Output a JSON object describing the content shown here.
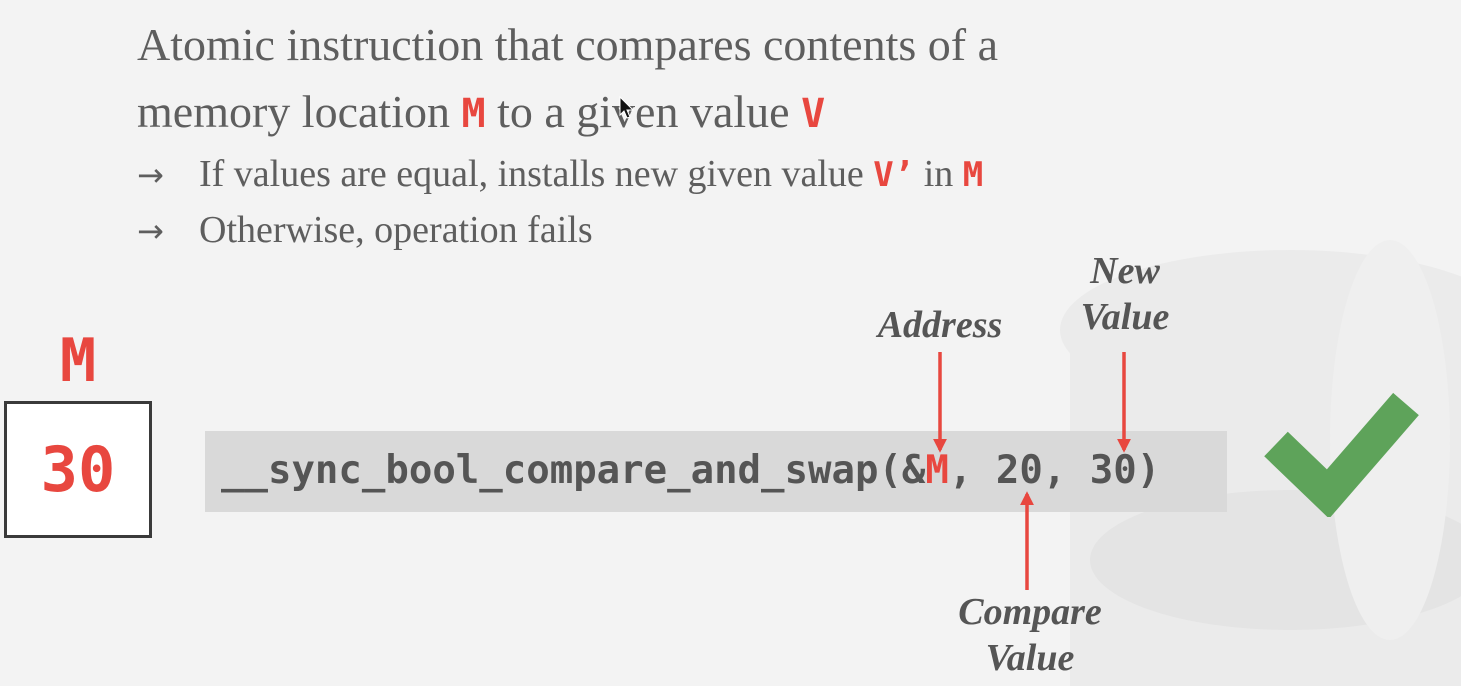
{
  "bullets": {
    "line1": "Atomic instruction that compares contents of a",
    "line2_pre": "memory location ",
    "line2_m": "M",
    "line2_mid": " to a given value ",
    "line2_v": "V",
    "sub1_arrow": "→",
    "sub1_pre": "If values are equal, installs new given value ",
    "sub1_v": "V’",
    "sub1_mid": " in ",
    "sub1_m": "M",
    "sub2_arrow": "→",
    "sub2_text": "Otherwise, operation fails"
  },
  "memory": {
    "label": "M",
    "value": "30"
  },
  "code": {
    "prefix": "__sync_bool_compare_and_swap(&",
    "address": "M",
    "suffix": ", 20, 30)"
  },
  "annotations": {
    "address": "Address",
    "new_value_1": "New",
    "new_value_2": "Value",
    "compare_value_1": "Compare",
    "compare_value_2": "Value"
  },
  "colors": {
    "accent_red": "#e8473f",
    "check_green": "#5ea35a",
    "text_gray": "#5e5e5e"
  },
  "icons": {
    "success": "checkmark-icon",
    "pointer": "mouse-cursor-icon"
  }
}
